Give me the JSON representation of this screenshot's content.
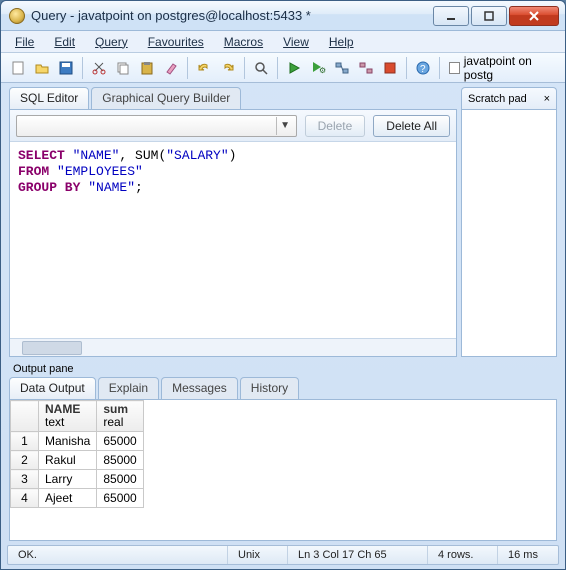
{
  "window": {
    "title": "Query - javatpoint on postgres@localhost:5433 *"
  },
  "menu": {
    "file": "File",
    "edit": "Edit",
    "query": "Query",
    "favourites": "Favourites",
    "macros": "Macros",
    "view": "View",
    "help": "Help"
  },
  "toolbar": {
    "connection_text": "javatpoint on postg"
  },
  "tabs": {
    "sql_editor": "SQL Editor",
    "gqb": "Graphical Query Builder"
  },
  "panel": {
    "delete_label": "Delete",
    "delete_all_label": "Delete All"
  },
  "sql": {
    "line1_kw1": "SELECT ",
    "line1_id1": "\"NAME\"",
    "line1_sep": ", ",
    "line1_func": "SUM",
    "line1_open": "(",
    "line1_id2": "\"SALARY\"",
    "line1_close": ")",
    "line2_kw": "FROM ",
    "line2_id": "\"EMPLOYEES\"",
    "line3_kw": "GROUP BY ",
    "line3_id": "\"NAME\"",
    "line3_end": ";"
  },
  "scratch": {
    "title": "Scratch pad",
    "close": "×"
  },
  "output": {
    "pane_title": "Output pane",
    "tab_data": "Data Output",
    "tab_explain": "Explain",
    "tab_messages": "Messages",
    "tab_history": "History",
    "col1_name": "NAME",
    "col1_type": "text",
    "col2_name": "sum",
    "col2_type": "real",
    "rows": [
      {
        "n": "1",
        "name": "Manisha",
        "sum": "65000"
      },
      {
        "n": "2",
        "name": "Rakul",
        "sum": "85000"
      },
      {
        "n": "3",
        "name": "Larry",
        "sum": "85000"
      },
      {
        "n": "4",
        "name": "Ajeet",
        "sum": "65000"
      }
    ]
  },
  "status": {
    "ok": "OK.",
    "encoding": "Unix",
    "position": "Ln 3 Col 17 Ch 65",
    "rows": "4 rows.",
    "time": "16 ms"
  }
}
